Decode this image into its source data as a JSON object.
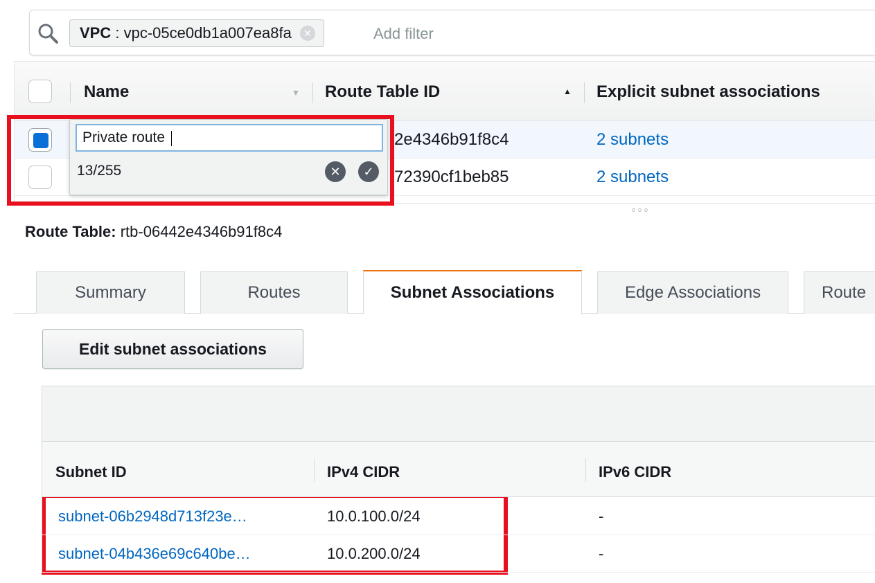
{
  "filter": {
    "token_key": "VPC",
    "token_sep": " : ",
    "token_value": "vpc-05ce0db1a007ea8fa",
    "add_filter_placeholder": "Add filter"
  },
  "route_tables": {
    "columns": [
      "Name",
      "Route Table ID",
      "Explicit subnet associations"
    ],
    "rows": [
      {
        "id_fragment": "2e4346b91f8c4",
        "associations": "2 subnets",
        "selected": true
      },
      {
        "id_fragment": "72390cf1beb85",
        "associations": "2 subnets",
        "selected": false
      }
    ]
  },
  "name_editor": {
    "value": "Private route",
    "char_count": "13/255",
    "cancel_symbol": "✕",
    "confirm_symbol": "✓"
  },
  "detail": {
    "label": "Route Table:",
    "value": "rtb-06442e4346b91f8c4"
  },
  "tabs": [
    "Summary",
    "Routes",
    "Subnet Associations",
    "Edge Associations",
    "Route"
  ],
  "active_tab": "Subnet Associations",
  "edit_button": "Edit subnet associations",
  "subnet_table": {
    "columns": [
      "Subnet ID",
      "IPv4 CIDR",
      "IPv6 CIDR"
    ],
    "rows": [
      {
        "subnet_id": "subnet-06b2948d713f23e…",
        "ipv4": "10.0.100.0/24",
        "ipv6": "-"
      },
      {
        "subnet_id": "subnet-04b436e69c640be…",
        "ipv4": "10.0.200.0/24",
        "ipv6": "-"
      }
    ]
  },
  "colors": {
    "link": "#0066c0",
    "highlight": "#e8101f",
    "active_tab": "#ec7211",
    "checkbox_checked": "#0a6fd6"
  }
}
